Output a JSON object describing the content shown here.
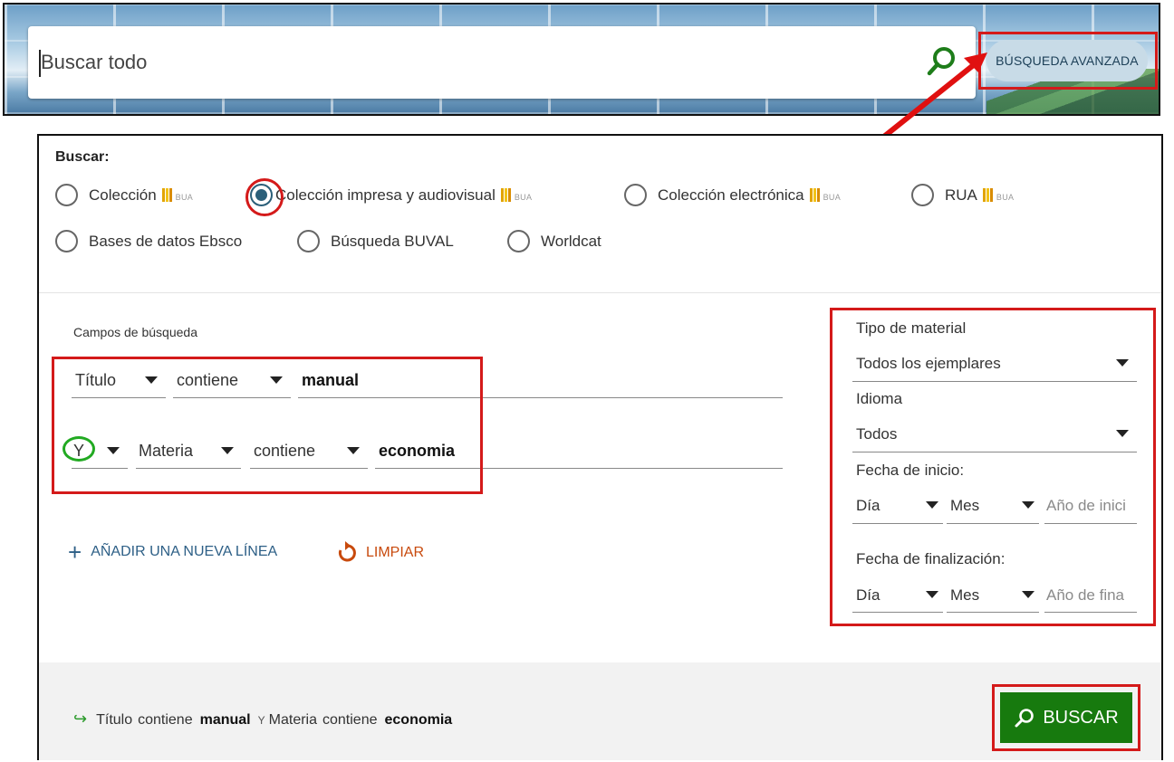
{
  "search": {
    "placeholder": "Buscar todo",
    "advanced_label": "BÚSQUEDA AVANZADA"
  },
  "scope": {
    "title": "Buscar:",
    "logo_text": "BUA",
    "options": [
      {
        "label": "Colección",
        "has_logo": true,
        "selected": false
      },
      {
        "label": "Colección impresa y audiovisual",
        "has_logo": true,
        "selected": true
      },
      {
        "label": "Colección electrónica",
        "has_logo": true,
        "selected": false
      },
      {
        "label": "RUA",
        "has_logo": true,
        "selected": false
      },
      {
        "label": "Bases de datos Ebsco",
        "has_logo": false,
        "selected": false
      },
      {
        "label": "Búsqueda BUVAL",
        "has_logo": false,
        "selected": false
      },
      {
        "label": "Worldcat",
        "has_logo": false,
        "selected": false
      }
    ]
  },
  "fields": {
    "title": "Campos de búsqueda",
    "rows": [
      {
        "operator": "",
        "field": "Título",
        "condition": "contiene",
        "value": "manual"
      },
      {
        "operator": "Y",
        "field": "Materia",
        "condition": "contiene",
        "value": "economia"
      }
    ],
    "add_line_label": "AÑADIR UNA NUEVA LÍNEA",
    "clear_label": "LIMPIAR"
  },
  "filters": {
    "material_label": "Tipo de material",
    "material_value": "Todos los ejemplares",
    "language_label": "Idioma",
    "language_value": "Todos",
    "start_label": "Fecha de inicio:",
    "end_label": "Fecha de finalización:",
    "day_label": "Día",
    "month_label": "Mes",
    "start_year_placeholder": "Año de inici",
    "end_year_placeholder": "Año de fina"
  },
  "footer": {
    "summary": {
      "field1": "Título",
      "cond1": "contiene",
      "value1": "manual",
      "operator": "Y",
      "field2": "Materia",
      "cond2": "contiene",
      "value2": "economia"
    },
    "search_label": "BUSCAR"
  },
  "colors": {
    "annotation_red": "#d41a1a",
    "annotation_green": "#22aa22",
    "primary_green": "#177a0e",
    "link_blue": "#2d5f86",
    "clear_orange": "#c84a0d"
  }
}
